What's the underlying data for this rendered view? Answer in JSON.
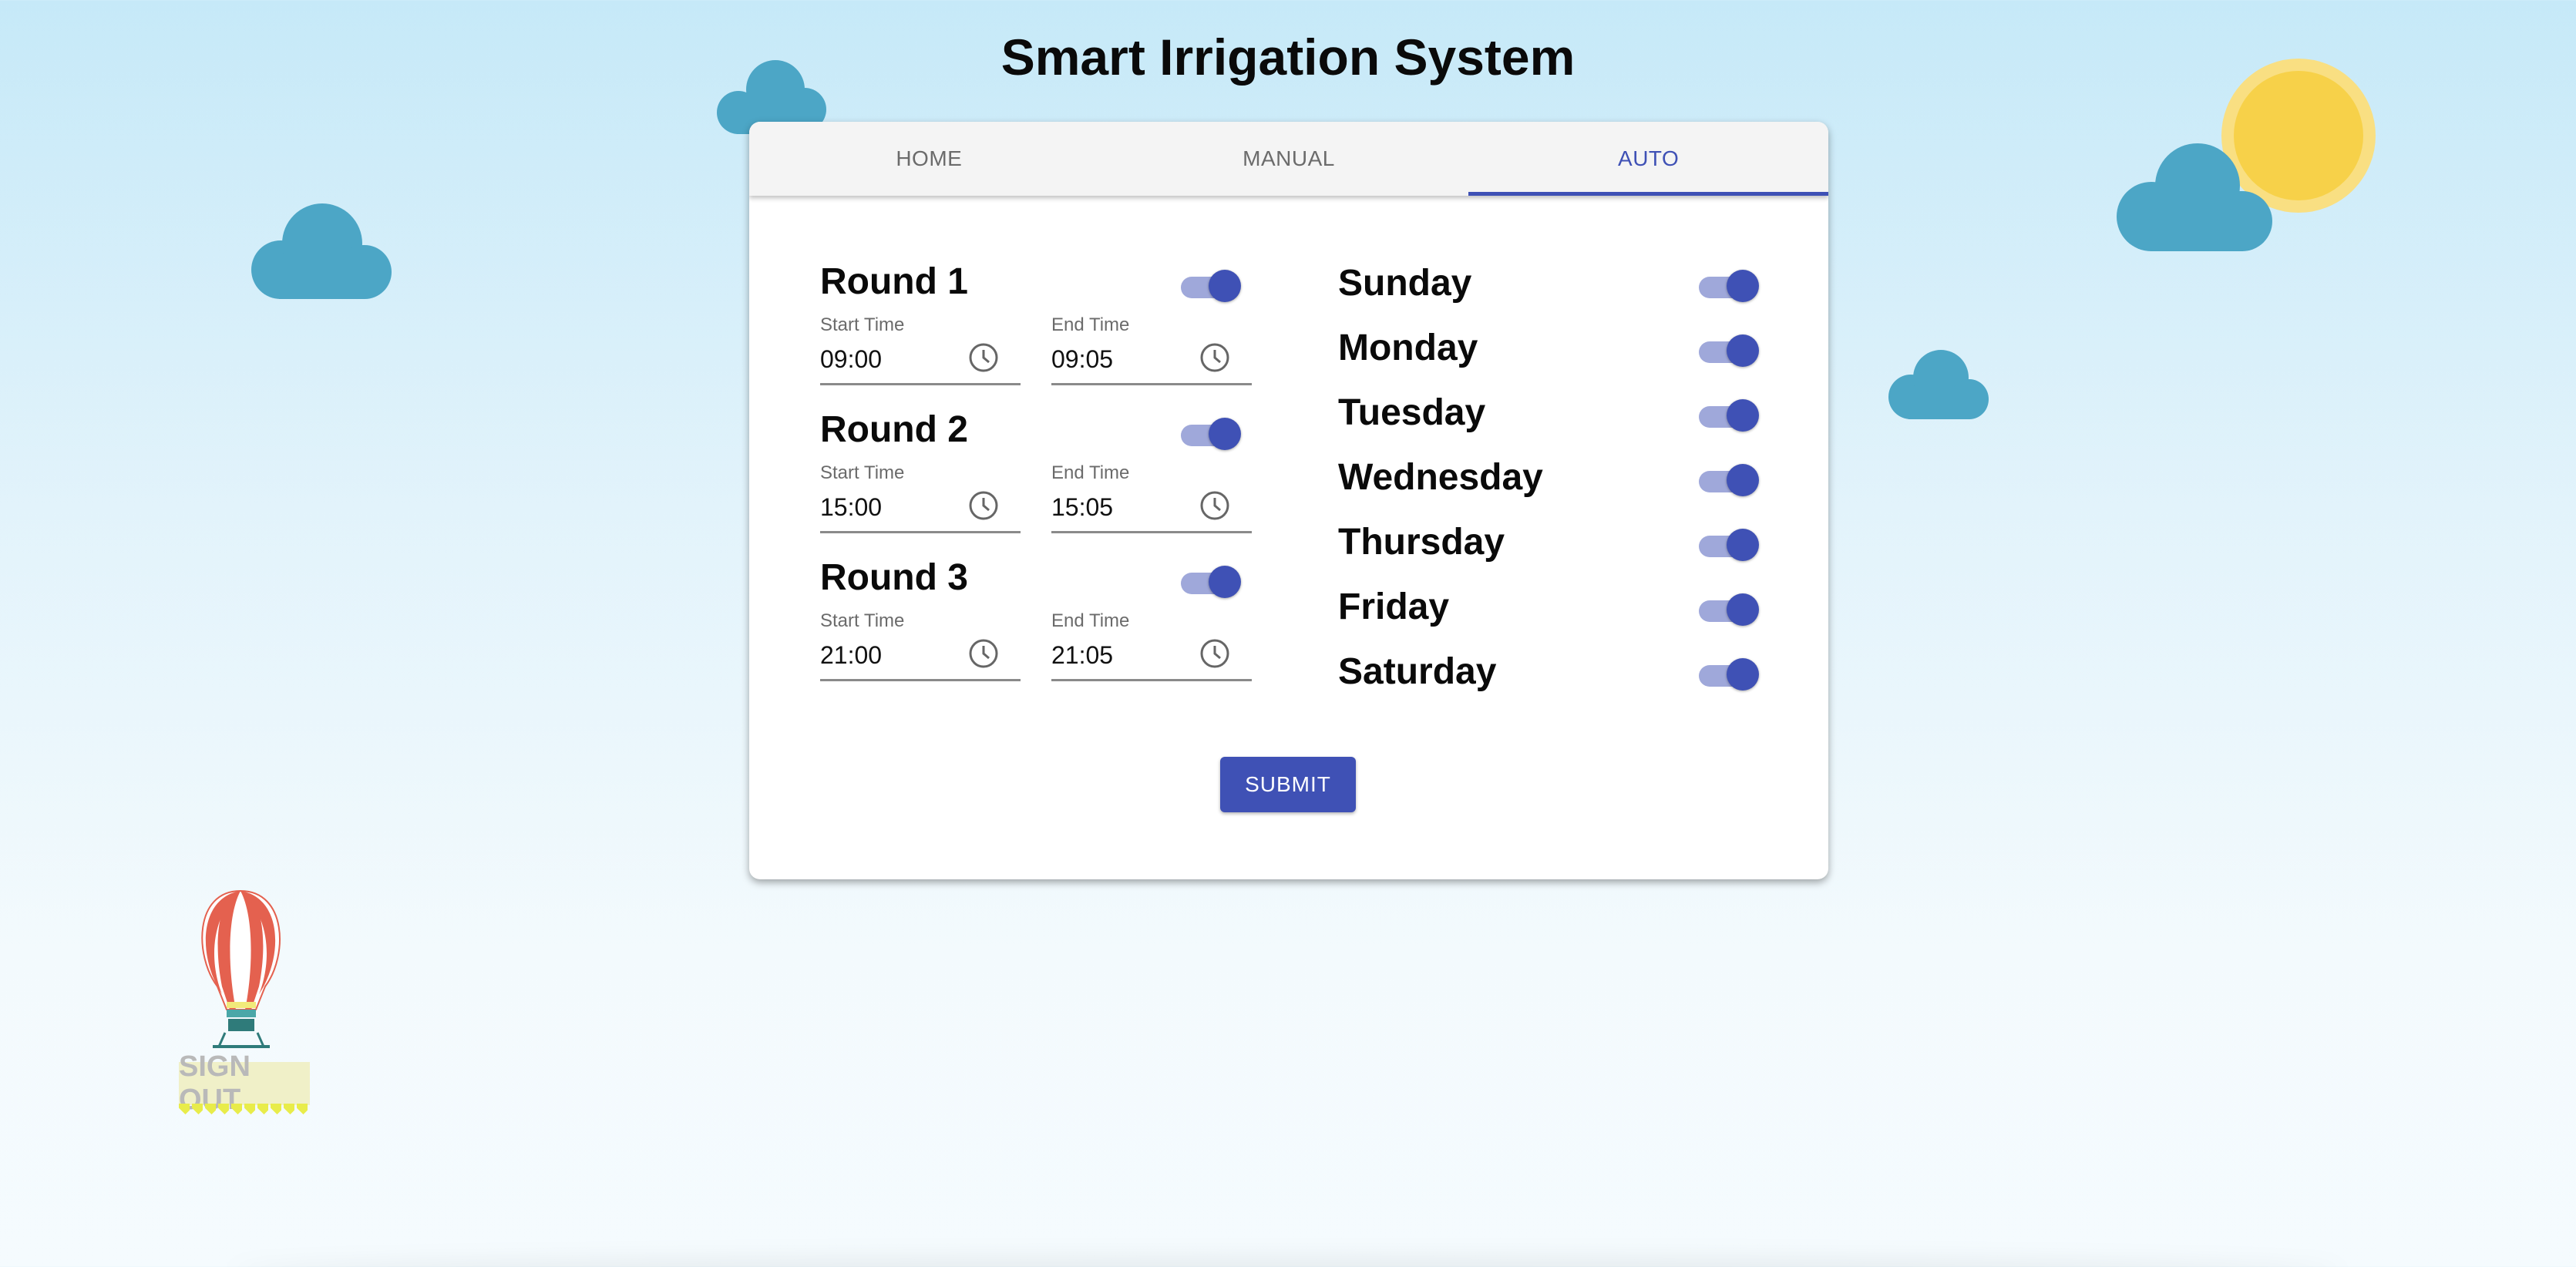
{
  "app": {
    "title": "Smart Irrigation System"
  },
  "tabs": [
    {
      "label": "HOME",
      "active": false
    },
    {
      "label": "MANUAL",
      "active": false
    },
    {
      "label": "AUTO",
      "active": true
    }
  ],
  "rounds": [
    {
      "label": "Round 1",
      "enabled": true,
      "start_label": "Start Time",
      "start": "09:00",
      "end_label": "End Time",
      "end": "09:05"
    },
    {
      "label": "Round 2",
      "enabled": true,
      "start_label": "Start Time",
      "start": "15:00",
      "end_label": "End Time",
      "end": "15:05"
    },
    {
      "label": "Round 3",
      "enabled": true,
      "start_label": "Start Time",
      "start": "21:00",
      "end_label": "End Time",
      "end": "21:05"
    }
  ],
  "days": [
    {
      "label": "Sunday",
      "enabled": true
    },
    {
      "label": "Monday",
      "enabled": true
    },
    {
      "label": "Tuesday",
      "enabled": true
    },
    {
      "label": "Wednesday",
      "enabled": true
    },
    {
      "label": "Thursday",
      "enabled": true
    },
    {
      "label": "Friday",
      "enabled": true
    },
    {
      "label": "Saturday",
      "enabled": true
    }
  ],
  "submit_label": "SUBMIT",
  "signout_label": "SIGN OUT",
  "colors": {
    "accent": "#3f51b5",
    "track": "#9fa8da",
    "cloud": "#4ca6c6",
    "sun": "#f7d149"
  }
}
